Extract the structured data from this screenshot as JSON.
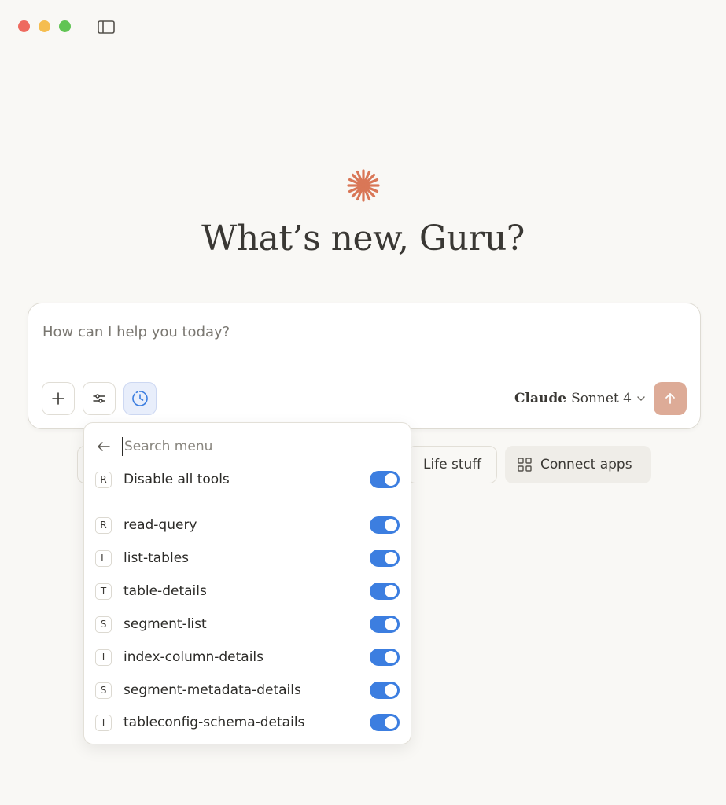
{
  "greeting": "What’s new, Guru?",
  "composer": {
    "placeholder": "How can I help you today?",
    "model_brand": "Claude",
    "model_name": "Sonnet 4"
  },
  "chips": {
    "life": "Life stuff",
    "connect": "Connect apps"
  },
  "menu": {
    "search_placeholder": "Search menu",
    "disable_all": {
      "badge": "R",
      "label": "Disable all tools",
      "enabled": true
    },
    "tools": [
      {
        "badge": "R",
        "label": "read-query",
        "enabled": true
      },
      {
        "badge": "L",
        "label": "list-tables",
        "enabled": true
      },
      {
        "badge": "T",
        "label": "table-details",
        "enabled": true
      },
      {
        "badge": "S",
        "label": "segment-list",
        "enabled": true
      },
      {
        "badge": "I",
        "label": "index-column-details",
        "enabled": true
      },
      {
        "badge": "S",
        "label": "segment-metadata-details",
        "enabled": true
      },
      {
        "badge": "T",
        "label": "tableconfig-schema-details",
        "enabled": true
      }
    ]
  },
  "colors": {
    "accent_spark": "#d97757",
    "toggle_on": "#3c7ee0",
    "send_button": "#ddab97",
    "background": "#f9f8f5"
  },
  "icons": {
    "sidebar_toggle": "sidebar-toggle-icon",
    "spark": "spark-logo-icon",
    "add": "plus-icon",
    "settings": "sliders-icon",
    "tools": "clock-icon",
    "model_chevron": "chevron-down-icon",
    "send": "arrow-up-icon",
    "back": "arrow-left-icon",
    "connect": "grid-icon"
  }
}
